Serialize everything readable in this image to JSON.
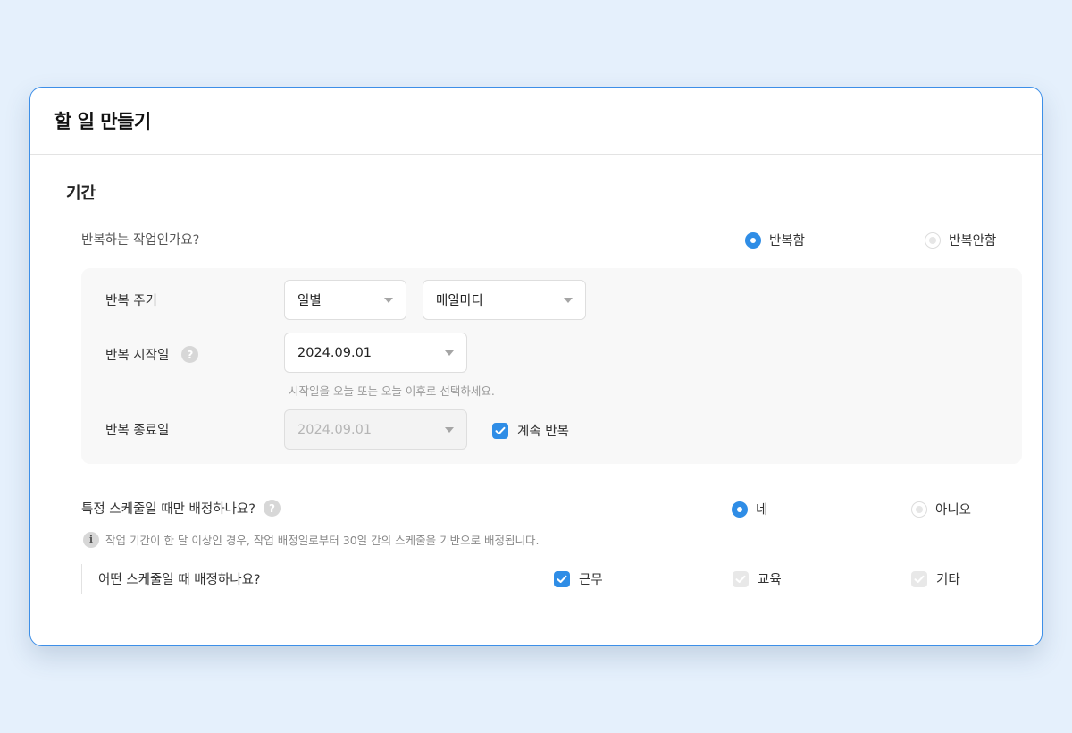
{
  "dialog": {
    "title": "할 일 만들기"
  },
  "period": {
    "section_title": "기간",
    "repeat_question": "반복하는 작업인가요?",
    "repeat_options": [
      {
        "label": "반복함",
        "selected": true
      },
      {
        "label": "반복안함",
        "selected": false
      }
    ],
    "cycle_label": "반복 주기",
    "cycle_unit": {
      "value": "일별"
    },
    "cycle_frequency": {
      "value": "매일마다"
    },
    "start_label": "반복 시작일",
    "start_date": {
      "value": "2024.09.01"
    },
    "start_hint": "시작일을 오늘 또는 오늘 이후로 선택하세요.",
    "end_label": "반복 종료일",
    "end_date": {
      "value": "2024.09.01",
      "disabled": true
    },
    "continue_repeat": {
      "label": "계속 반복",
      "checked": true
    }
  },
  "schedule": {
    "question": "특정 스케줄일 때만 배정하나요?",
    "options": [
      {
        "label": "네",
        "selected": true
      },
      {
        "label": "아니오",
        "selected": false
      }
    ],
    "info_text": "작업 기간이 한 달 이상인 경우, 작업 배정일로부터 30일 간의 스케줄을 기반으로 배정됩니다.",
    "which_question": "어떤 스케줄일 때 배정하나요?",
    "types": [
      {
        "label": "근무",
        "checked": true
      },
      {
        "label": "교육",
        "checked": false
      },
      {
        "label": "기타",
        "checked": false
      }
    ]
  },
  "colors": {
    "accent": "#2f8de6",
    "background": "#e5f0fc",
    "card_border": "#3d8fe8"
  },
  "icons": {
    "help": "question-circle-icon",
    "info": "info-circle-icon",
    "caret": "chevron-down-icon"
  }
}
